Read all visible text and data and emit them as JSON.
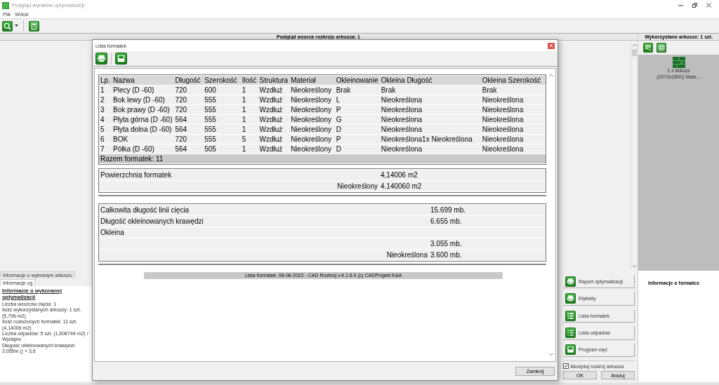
{
  "window": {
    "title": "Podgląd wyników optymalizacji",
    "menu": [
      "Plik",
      "Widok"
    ]
  },
  "preview": {
    "title": "Podgląd wzorca rozkroju arkusza: 1"
  },
  "sheets_panel": {
    "title": "Wykorzystane arkusze: 1 szt.",
    "sheets": [
      {
        "lines": [
          "1 x Arkusz",
          "(2070x2800) Mate..."
        ]
      }
    ]
  },
  "info_tabs": [
    {
      "label": "Informacje o wybranym arkuszu",
      "selected": false
    },
    {
      "label": "Informacje og",
      "selected": true
    }
  ],
  "optimization_info": {
    "heading": "Informacje o wykonanej optymalizacji",
    "lines": [
      "Liczba wzorców cięcia: 1",
      "Ilość wykorzystanych arkuszy: 1 szt. (5,796 m2)",
      "Ilość rozłożonych formatek: 11 szt. (4,14006 m2)",
      "Liczba odpadów: 5 szt. (1,608744 m2) / Wydajno",
      "Długość okleinowanych krawędzi: 3,055m () + 3,6"
    ]
  },
  "actions": [
    {
      "label": "Raport optymalizacji",
      "kind": "print"
    },
    {
      "label": "Etykiety",
      "kind": "print"
    },
    {
      "label": "Lista formatek",
      "kind": "list"
    },
    {
      "label": "Lista odpadów",
      "kind": "checklist"
    },
    {
      "label": "Program cięć",
      "kind": "save"
    }
  ],
  "accept": {
    "label": "Akceptuj rozkrój arkusza",
    "checked": true
  },
  "buttons": [
    "OK",
    "Anuluj"
  ],
  "part_info": {
    "title": "Informacje o formatce"
  },
  "dialog": {
    "title": "Lista formatek",
    "table": {
      "columns": [
        "Lp.",
        "Nazwa",
        "Długość",
        "Szerokość",
        "Ilość",
        "Struktura",
        "Materiał",
        "Okleinowanie",
        "Okleina Długość",
        "Okleina Szerokość"
      ],
      "rows": [
        [
          "1",
          "Plecy (D -60)",
          "720",
          "600",
          "1",
          "Wzdłuż",
          "Nieokreślony",
          "Brak",
          "Brak",
          "Brak"
        ],
        [
          "2",
          "Bok lewy (D -60)",
          "720",
          "555",
          "1",
          "Wzdłuż",
          "Nieokreślony",
          "L",
          "Nieokreślona",
          "Nieokreślona"
        ],
        [
          "3",
          "Bok prawy (D -60)",
          "720",
          "555",
          "1",
          "Wzdłuż",
          "Nieokreślony",
          "P",
          "Nieokreślona",
          "Nieokreślona"
        ],
        [
          "4",
          "Płyta górna (D -60)",
          "564",
          "555",
          "1",
          "Wzdłuż",
          "Nieokreślony",
          "G",
          "Nieokreślona",
          "Nieokreślona"
        ],
        [
          "5",
          "Płyta dolna (D -60)",
          "564",
          "555",
          "1",
          "Wzdłuż",
          "Nieokreślony",
          "D",
          "Nieokreślona",
          "Nieokreślona"
        ],
        [
          "6",
          "BOK",
          "720",
          "555",
          "5",
          "Wzdłuż",
          "Nieokreślony",
          "P",
          "Nieokreślona1x Nieokreślona",
          "Nieokreślona"
        ],
        [
          "7",
          "Półka (D -60)",
          "564",
          "505",
          "1",
          "Wzdłuż",
          "Nieokreślony",
          "D",
          "Nieokreślona",
          "Nieokreślona"
        ]
      ],
      "footer": "Razem formatek: 11"
    },
    "area_table": {
      "rows": [
        {
          "kind": "main",
          "label": "Powierzchnia formatek",
          "value": "4,14006 m2"
        },
        {
          "kind": "sub",
          "label": "Nieokreślony",
          "value": "4.140060 m2"
        }
      ]
    },
    "length_table": {
      "rows": [
        {
          "kind": "main",
          "label": "Całkowita długość linii cięcia",
          "value": "15.699 mb."
        },
        {
          "kind": "main",
          "label": "Długość okleinowanych krawędzi",
          "value": "6.655 mb."
        },
        {
          "kind": "main",
          "label": "Okleina"
        },
        {
          "kind": "sub",
          "value": "3.055 mb."
        },
        {
          "kind": "sub",
          "label": "Nieokreślona",
          "value": "3.600 mb."
        }
      ]
    },
    "footer": "Lista formatek: 06-06-2022 - CAD Rozkrój v.4.1.6.0 (c) CADProjekt K&A",
    "close_button": "Zamknij"
  }
}
